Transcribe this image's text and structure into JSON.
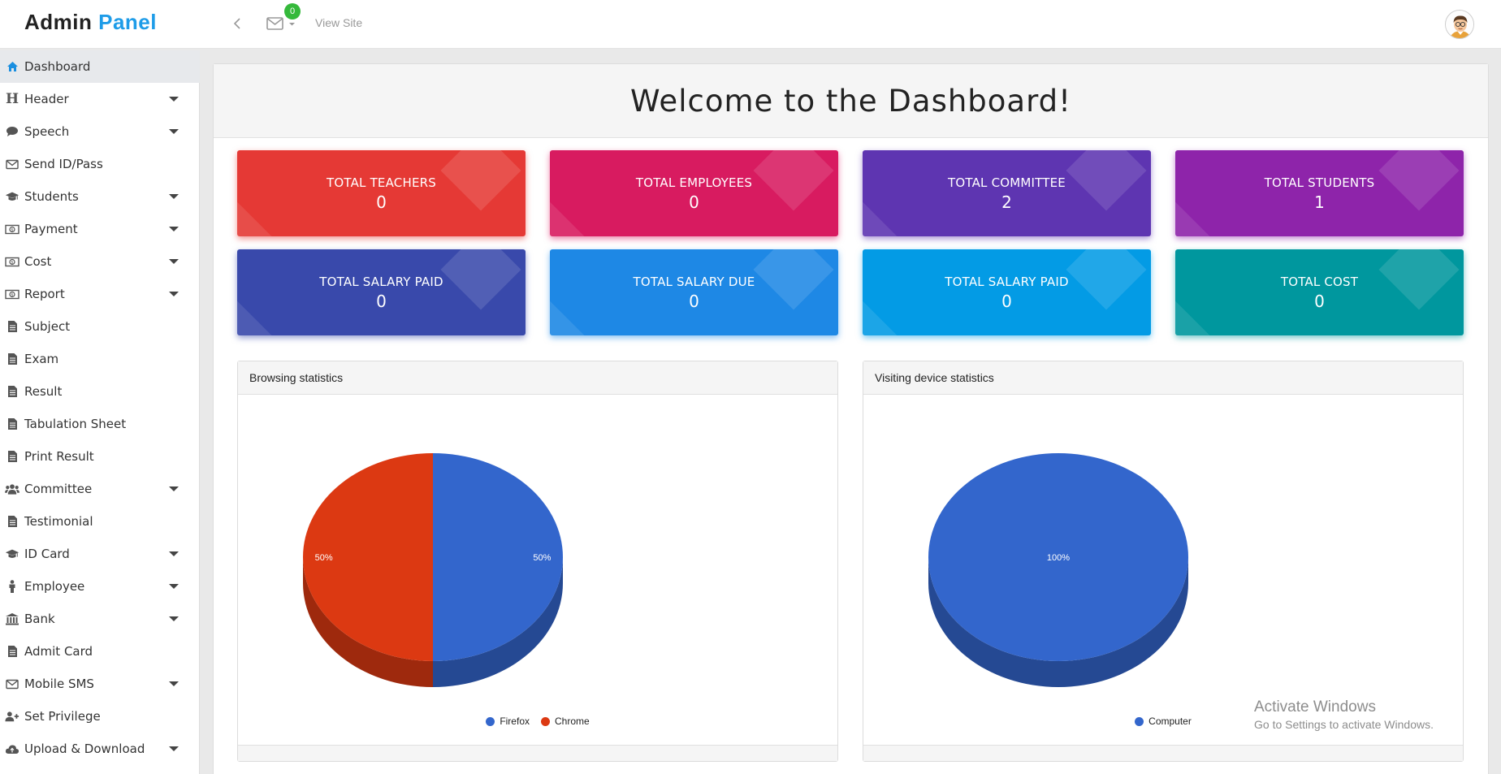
{
  "brand": {
    "part1": "Admin",
    "part2": "Panel"
  },
  "topbar": {
    "mail_count": "0",
    "view_site": "View Site"
  },
  "sidebar": {
    "items": [
      {
        "label": "Dashboard",
        "icon": "home-icon",
        "expandable": false,
        "active": true
      },
      {
        "label": "Header",
        "icon": "header-icon",
        "expandable": true
      },
      {
        "label": "Speech",
        "icon": "comment-icon",
        "expandable": true
      },
      {
        "label": "Send ID/Pass",
        "icon": "envelope-icon",
        "expandable": false
      },
      {
        "label": "Students",
        "icon": "graduation-cap-icon",
        "expandable": true
      },
      {
        "label": "Payment",
        "icon": "money-icon",
        "expandable": true
      },
      {
        "label": "Cost",
        "icon": "money-icon",
        "expandable": true
      },
      {
        "label": "Report",
        "icon": "money-icon",
        "expandable": true
      },
      {
        "label": "Subject",
        "icon": "file-icon",
        "expandable": false
      },
      {
        "label": "Exam",
        "icon": "file-icon",
        "expandable": false
      },
      {
        "label": "Result",
        "icon": "file-icon",
        "expandable": false
      },
      {
        "label": "Tabulation Sheet",
        "icon": "file-icon",
        "expandable": false
      },
      {
        "label": "Print Result",
        "icon": "file-icon",
        "expandable": false
      },
      {
        "label": "Committee",
        "icon": "users-icon",
        "expandable": true
      },
      {
        "label": "Testimonial",
        "icon": "file-icon",
        "expandable": false
      },
      {
        "label": "ID Card",
        "icon": "graduation-cap-icon",
        "expandable": true
      },
      {
        "label": "Employee",
        "icon": "male-icon",
        "expandable": true
      },
      {
        "label": "Bank",
        "icon": "bank-icon",
        "expandable": true
      },
      {
        "label": "Admit Card",
        "icon": "file-icon",
        "expandable": false
      },
      {
        "label": "Mobile SMS",
        "icon": "envelope-icon",
        "expandable": true
      },
      {
        "label": "Set Privilege",
        "icon": "user-plus-icon",
        "expandable": false
      },
      {
        "label": "Upload & Download",
        "icon": "cloud-icon",
        "expandable": true
      }
    ]
  },
  "welcome": "Welcome to the Dashboard!",
  "cards": [
    {
      "label": "TOTAL TEACHERS",
      "value": "0",
      "color": "#e53935"
    },
    {
      "label": "TOTAL EMPLOYEES",
      "value": "0",
      "color": "#d81b60"
    },
    {
      "label": "TOTAL COMMITTEE",
      "value": "2",
      "color": "#5e35b1"
    },
    {
      "label": "TOTAL STUDENTS",
      "value": "1",
      "color": "#8e24aa"
    },
    {
      "label": "TOTAL SALARY PAID",
      "value": "0",
      "color": "#3949ab"
    },
    {
      "label": "TOTAL SALARY DUE",
      "value": "0",
      "color": "#1e88e5"
    },
    {
      "label": "TOTAL SALARY PAID",
      "value": "0",
      "color": "#039be5"
    },
    {
      "label": "TOTAL COST",
      "value": "0",
      "color": "#00979e"
    }
  ],
  "panels": {
    "browsing": {
      "title": "Browsing statistics"
    },
    "device": {
      "title": "Visiting device statistics"
    }
  },
  "chart_data": [
    {
      "type": "pie",
      "title": "",
      "labels": [
        "Firefox",
        "Chrome"
      ],
      "values": [
        50,
        50
      ],
      "data_labels": [
        "50%",
        "50%"
      ],
      "colors": [
        "#3366cc",
        "#dc3912"
      ],
      "legend": "bottom",
      "style": "3d"
    },
    {
      "type": "pie",
      "title": "",
      "labels": [
        "Computer"
      ],
      "values": [
        100
      ],
      "data_labels": [
        "100%"
      ],
      "colors": [
        "#3366cc"
      ],
      "legend": "bottom",
      "style": "3d"
    }
  ],
  "windows_watermark": {
    "line1": "Activate Windows",
    "line2": "Go to Settings to activate Windows."
  }
}
